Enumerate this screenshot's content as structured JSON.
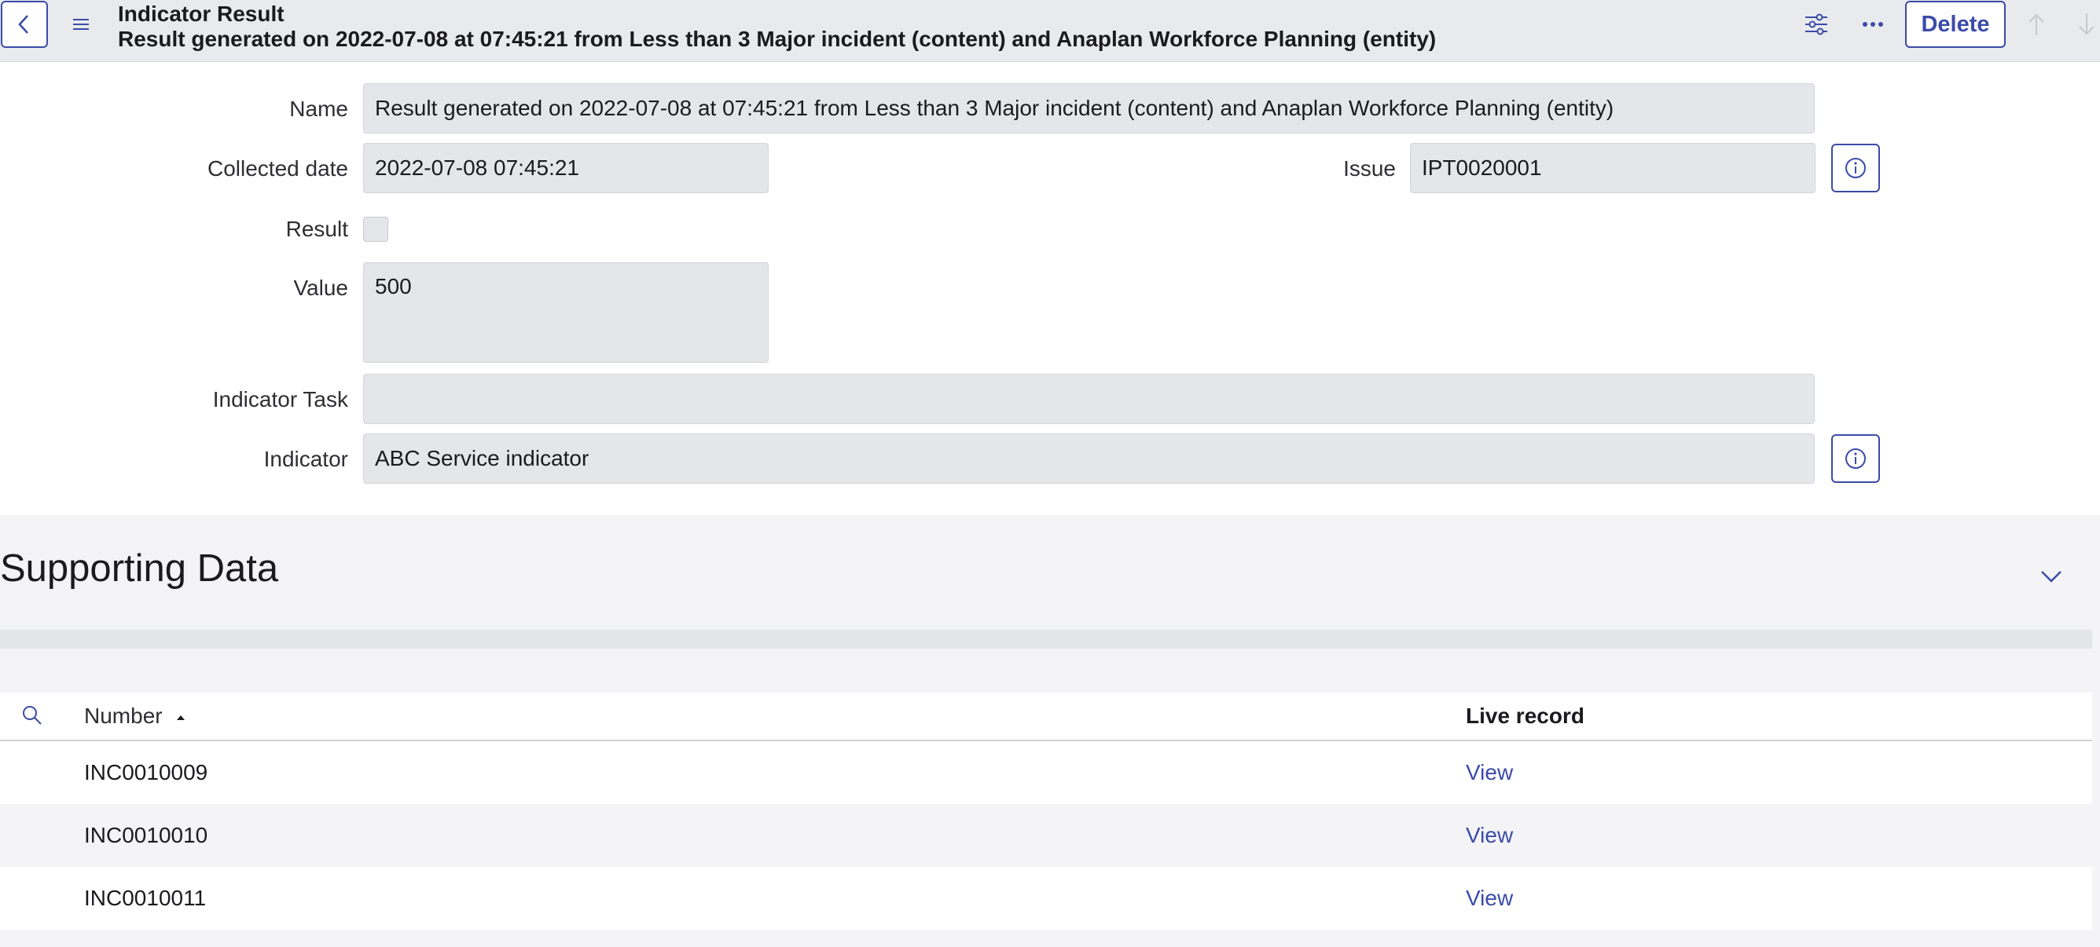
{
  "header": {
    "title": "Indicator Result",
    "subtitle": "Result generated on 2022-07-08 at 07:45:21 from Less than 3 Major incident (content) and Anaplan Workforce Planning (entity)",
    "delete_label": "Delete",
    "icons": [
      "back-icon",
      "hamburger-menu-icon",
      "form-settings-icon",
      "more-options-icon",
      "previous-record-icon",
      "next-record-icon"
    ]
  },
  "form": {
    "name": {
      "label": "Name",
      "value": "Result generated on 2022-07-08 at 07:45:21 from Less than 3 Major incident (content) and Anaplan Workforce Planning (entity)"
    },
    "collected_date": {
      "label": "Collected date",
      "value": "2022-07-08 07:45:21"
    },
    "issue": {
      "label": "Issue",
      "value": "IPT0020001"
    },
    "result": {
      "label": "Result",
      "checked": false
    },
    "value": {
      "label": "Value",
      "value": "500"
    },
    "indicator_task": {
      "label": "Indicator Task",
      "value": ""
    },
    "indicator": {
      "label": "Indicator",
      "value": "ABC Service indicator"
    }
  },
  "supporting_data": {
    "title": "Supporting Data",
    "columns": {
      "number": "Number",
      "live_record": "Live record"
    },
    "sort": "number-ascending",
    "rows": [
      {
        "number": "INC0010009",
        "live_record": "View"
      },
      {
        "number": "INC0010010",
        "live_record": "View"
      },
      {
        "number": "INC0010011",
        "live_record": "View"
      }
    ]
  },
  "colors": {
    "accent": "#3b4ba8",
    "header_bg": "#e9eaee",
    "field_bg": "#e5e6ea",
    "section_bg": "#f4f4f6"
  }
}
